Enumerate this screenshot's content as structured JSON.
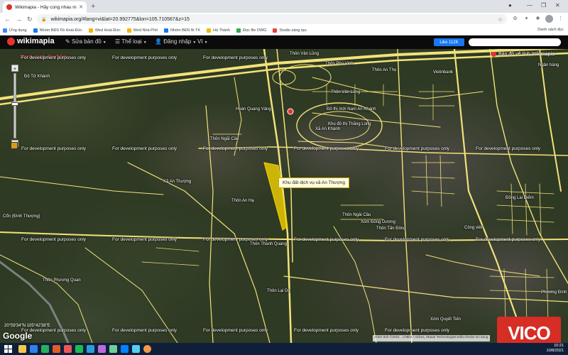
{
  "browser": {
    "tab_title": "Wikimapia - Hãy cùng nhau mô tả thế g...",
    "url": "wikimapia.org/#lang=vi&lat=20.992775&lon=105.710567&z=15",
    "bookmarks": [
      {
        "label": "Ứng dụng",
        "color": "#4285f4"
      },
      {
        "label": "Nhóm BĐS Fb Hoài Đức",
        "color": "#1877f2"
      },
      {
        "label": "Wed Hoài Đức",
        "color": "#f4b400"
      },
      {
        "label": "Wed Nhà Phố",
        "color": "#f4b400"
      },
      {
        "label": "Nhóm BĐS fb TK",
        "color": "#1877f2"
      },
      {
        "label": "Hà Thành",
        "color": "#f4b400"
      },
      {
        "label": "Đọc file DWG",
        "color": "#34a853"
      },
      {
        "label": "Studio sáng tạo",
        "color": "#ea4335"
      }
    ],
    "other_bookmarks": "Danh sách đọc"
  },
  "wikimapia": {
    "logo_text": "wikimapia",
    "menu": {
      "edit_map": "Sửa bản đồ",
      "categories": "Thể loại",
      "login": "Đăng nhập",
      "lang": "VI"
    },
    "like_label": "Like 112K",
    "satellite_link": "Bản đồ vệ tinh Wikimapia",
    "map_places_title": "Danh sách địa điểm"
  },
  "map": {
    "dev_text": "For development purposes only",
    "popup": "Khu đất dịch vụ xã An Thượng",
    "coords": "20°59'34\"N 105°42'38\"E",
    "google": "Google",
    "attribution": "Hình ảnh ©2021 , CNES / Airbus, Maxar Technologies  Điều khoản sử dụng",
    "labels": {
      "l1": "Thôn Vân Lũng",
      "l2": "Thôn Phú Vinh",
      "l3": "Thôn An Thọ",
      "l4": "Vietinbank",
      "l5": "Ngân hàng",
      "l6": "Hoàn Quang Vàng",
      "l7": "Đô thị mới Nam An Khánh",
      "l8": "Khu đô thị Thăng Long",
      "l9": "Thôn Ngãi Cầu",
      "l10": "Xã An Thượng",
      "l11": "Thôn An Hạ",
      "l12": "Thôn Ngải Cầu",
      "l13": "Xóm Đồng Dương",
      "l14": "Xã An Khánh",
      "l15": "Thôn Thanh Quang",
      "l16": "Thôn Phương Quan",
      "l17": "Thôn Lại Du",
      "l18": "Cổn (Đình Thượng)",
      "l19": "Xóm Quyết Tiến",
      "l20": "Công viên",
      "l21": "Đồng Lai Điểm",
      "l22": "Thôn Tấn Đông",
      "l23": "Đô Tử Khánh",
      "l24": "Phương Đình",
      "l25": "Thôn Vân Lũng"
    }
  },
  "taskbar": {
    "time": "10:21",
    "date": "10/8/2021"
  },
  "brand": {
    "vico_text": "VICO",
    "accent": "#d62d25",
    "road_color": "#f2e27a"
  }
}
